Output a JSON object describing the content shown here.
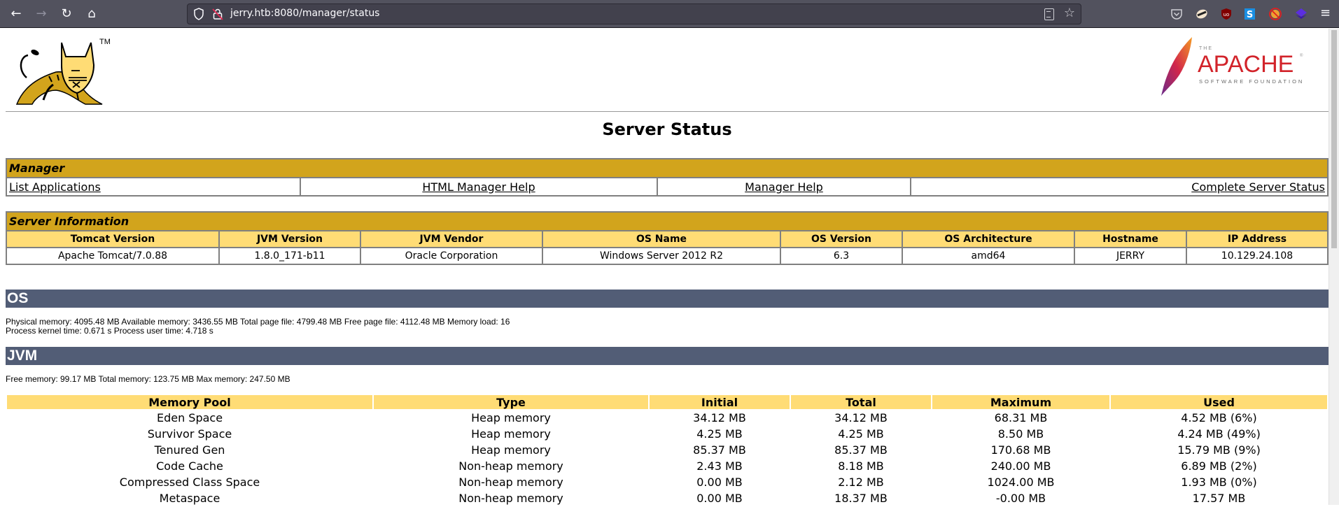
{
  "browser": {
    "url": "jerry.htb:8080/manager/status",
    "nav": {
      "back": "←",
      "forward": "→",
      "reload": "↻",
      "home": "⌂"
    },
    "icons": [
      "shield-icon",
      "insecure-lock-icon",
      "reader-view-icon",
      "bookmark-star-icon",
      "pocket-icon",
      "extension-badger-icon",
      "ublock-origin-icon",
      "extension-s-icon",
      "extension-blocked-icon",
      "extension-purple-icon",
      "menu-icon"
    ],
    "menu_glyph": "≡",
    "star_glyph": "☆"
  },
  "header": {
    "tomcat_tm": "TM",
    "apache_the": "THE",
    "apache_name": "APACHE",
    "apache_sub": "SOFTWARE FOUNDATION",
    "apache_reg": "®"
  },
  "page_title": "Server Status",
  "manager": {
    "title": "Manager",
    "links": [
      "List Applications",
      "HTML Manager Help",
      "Manager Help",
      "Complete Server Status"
    ]
  },
  "server_info": {
    "title": "Server Information",
    "headers": [
      "Tomcat Version",
      "JVM Version",
      "JVM Vendor",
      "OS Name",
      "OS Version",
      "OS Architecture",
      "Hostname",
      "IP Address"
    ],
    "values": [
      "Apache Tomcat/7.0.88",
      "1.8.0_171-b11",
      "Oracle Corporation",
      "Windows Server 2012 R2",
      "6.3",
      "amd64",
      "JERRY",
      "10.129.24.108"
    ]
  },
  "os": {
    "title": "OS",
    "line1": "Physical memory: 4095.48 MB Available memory: 3436.55 MB Total page file: 4799.48 MB Free page file: 4112.48 MB Memory load: 16",
    "line2": "Process kernel time: 0.671 s Process user time: 4.718 s"
  },
  "jvm": {
    "title": "JVM",
    "line1": "Free memory: 99.17 MB Total memory: 123.75 MB Max memory: 247.50 MB",
    "memory_table": {
      "headers": [
        "Memory Pool",
        "Type",
        "Initial",
        "Total",
        "Maximum",
        "Used"
      ],
      "rows": [
        [
          "Eden Space",
          "Heap memory",
          "34.12 MB",
          "34.12 MB",
          "68.31 MB",
          "4.52 MB (6%)"
        ],
        [
          "Survivor Space",
          "Heap memory",
          "4.25 MB",
          "4.25 MB",
          "8.50 MB",
          "4.24 MB (49%)"
        ],
        [
          "Tenured Gen",
          "Heap memory",
          "85.37 MB",
          "85.37 MB",
          "170.68 MB",
          "15.79 MB (9%)"
        ],
        [
          "Code Cache",
          "Non-heap memory",
          "2.43 MB",
          "8.18 MB",
          "240.00 MB",
          "6.89 MB (2%)"
        ],
        [
          "Compressed Class Space",
          "Non-heap memory",
          "0.00 MB",
          "2.12 MB",
          "1024.00 MB",
          "1.93 MB (0%)"
        ],
        [
          "Metaspace",
          "Non-heap memory",
          "0.00 MB",
          "18.37 MB",
          "-0.00 MB",
          "17.57 MB"
        ]
      ]
    }
  },
  "colors": {
    "section_title_bg": "#d2a41c",
    "header_row_bg": "#ffdc75",
    "bar_bg": "#525d76",
    "toolbar_bg": "#52525e"
  }
}
